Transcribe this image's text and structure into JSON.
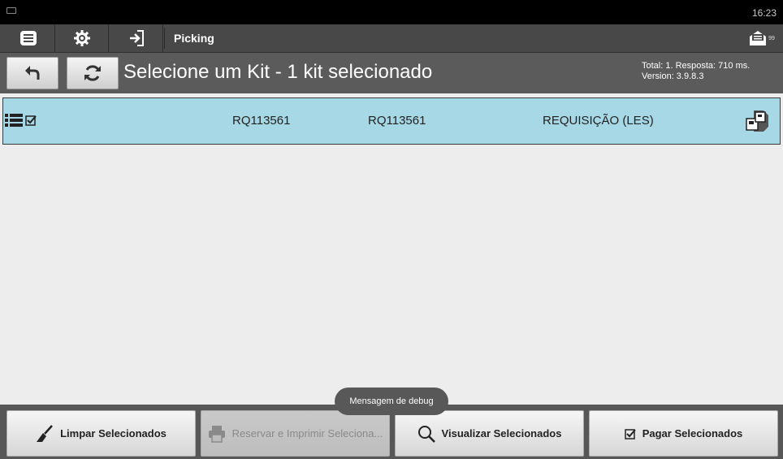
{
  "status_bar": {
    "time": "16:23"
  },
  "action_bar": {
    "title": "Picking",
    "inbox_badge": "99"
  },
  "header": {
    "title": "Selecione um Kit - 1 kit selecionado",
    "info_line1": "Total: 1. Resposta: 710 ms.",
    "info_line2": "Version: 3.9.8.3"
  },
  "kits": [
    {
      "code": "RQ113561",
      "reference": "RQ113561",
      "type": "REQUISIÇÃO (LES)",
      "selected": true
    }
  ],
  "toast": {
    "text": "Mensagem de debug"
  },
  "bottom_bar": {
    "clear_label": "Limpar Selecionados",
    "reserve_print_label": "Reservar e Imprimir Seleciona...",
    "view_label": "Visualizar Selecionados",
    "pay_label": "Pagar Selecionados"
  },
  "colors": {
    "selected_row": "#a7d8e6",
    "action_bar": "#484848",
    "header_bar": "#5b5b5b"
  }
}
